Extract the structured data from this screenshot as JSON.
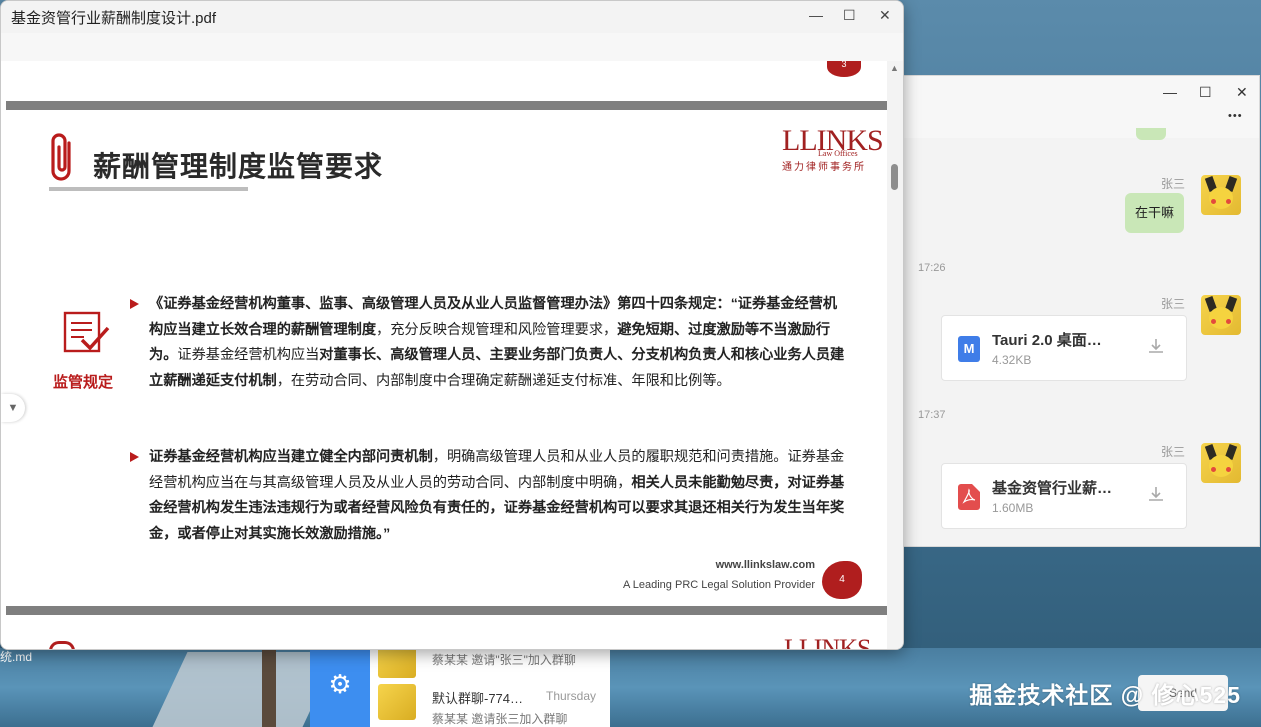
{
  "pdf_window": {
    "title": "基金资管行业薪酬制度设计.pdf",
    "controls": {
      "minimize": "—",
      "maximize": "☐",
      "close": "✕"
    }
  },
  "pdf_page": {
    "prev_page_number": "3",
    "heading": "薪酬管理制度监管要求",
    "logo": {
      "mark": "LLINKS",
      "sub": "Law Offices",
      "cn": "通力律师事务所"
    },
    "side_label": "监管规定",
    "para1": {
      "b1": "《证券基金经营机构董事、监事、高级管理人员及从业人员监督管理办法》第四十四条规定：“证券基金经营机构应当建立长效合理的薪酬管理制度",
      "t1": "，充分反映合规管理和风险管理要求，",
      "b2": "避免短期、过度激励等不当激励行为。",
      "t2": "证券基金经营机构应当",
      "b3": "对董事长、高级管理人员、主要业务部门负责人、分支机构负责人和核心业务人员建立薪酬递延支付机制",
      "t3": "，在劳动合同、内部制度中合理确定薪酬递延支付标准、年限和比例等。"
    },
    "para2": {
      "b1": "证券基金经营机构应当建立健全内部问责机制",
      "t1": "，明确高级管理人员和从业人员的履职规范和问责措施。证券基金经营机构应当在与其高级管理人员及从业人员的劳动合同、内部制度中明确，",
      "b2": "相关人员未能勤勉尽责，对证券基金经营机构发生违法违规行为或者经营风险负有责任的，证券基金经营机构可以要求其退还相关行为发生当年奖金，或者停止对其实施长效激励措施。”"
    },
    "footer_url": "www.llinkslaw.com",
    "footer_tagline": "A Leading PRC Legal Solution Provider",
    "page_number": "4"
  },
  "chat_window": {
    "controls": {
      "minimize": "—",
      "maximize": "☐",
      "close": "✕",
      "more": "•••"
    },
    "messages": [
      {
        "sender": "张三",
        "text": "在干嘛"
      },
      {
        "time": "17:26"
      },
      {
        "sender": "张三",
        "file_name": "Tauri 2.0 桌面…",
        "file_size": "4.32KB",
        "file_type": "markdown",
        "icon": "M"
      },
      {
        "time": "17:37"
      },
      {
        "sender": "张三",
        "file_name": "基金资管行业薪…",
        "file_size": "1.60MB",
        "file_type": "pdf",
        "icon": "pdf-icon"
      }
    ],
    "send_label": "Send"
  },
  "chat_list": {
    "items": [
      {
        "name": "",
        "preview": "蔡某某 邀请\"张三\"加入群聊",
        "time": ""
      },
      {
        "name": "默认群聊-774…",
        "preview": "蔡某某 邀请张三加入群聊",
        "time": "Thursday"
      }
    ]
  },
  "desktop": {
    "file_label": "统.md",
    "watermark": "掘金技术社区 @ 修心525"
  },
  "colors": {
    "accent_red": "#b91c1c",
    "chat_green": "#c9e7b7",
    "gear_blue": "#3d8ef0"
  }
}
